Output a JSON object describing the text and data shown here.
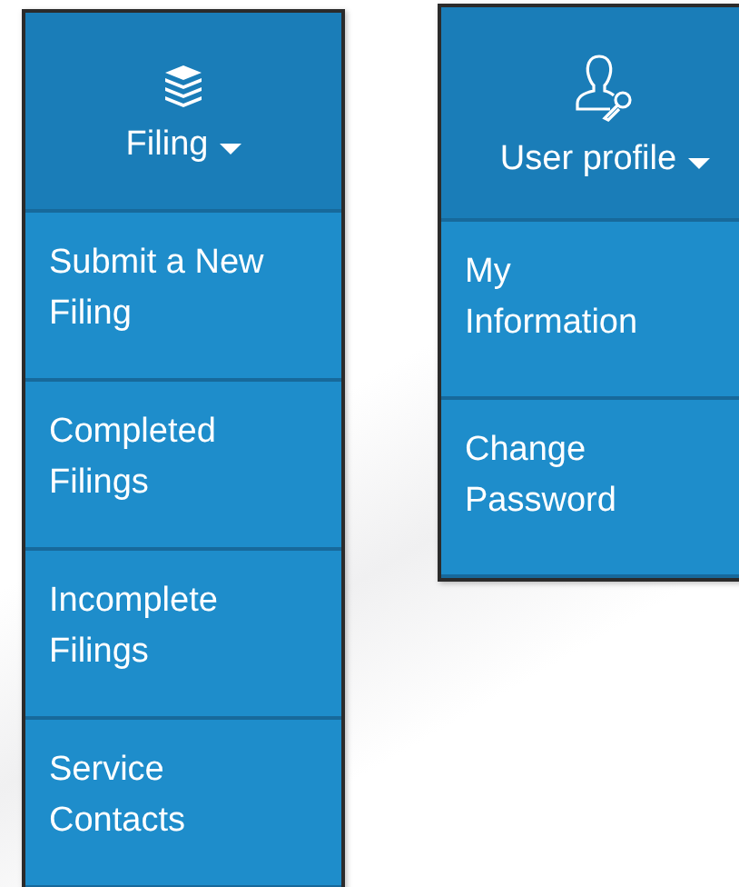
{
  "menus": [
    {
      "title": "Filing",
      "kind": "layers",
      "items": [
        "Submit a New Filing",
        "Completed Filings",
        "Incomplete Filings",
        "Service Contacts"
      ]
    },
    {
      "title": "User profile",
      "kind": "user-key",
      "items": [
        "My Information",
        "Change Password"
      ]
    }
  ]
}
